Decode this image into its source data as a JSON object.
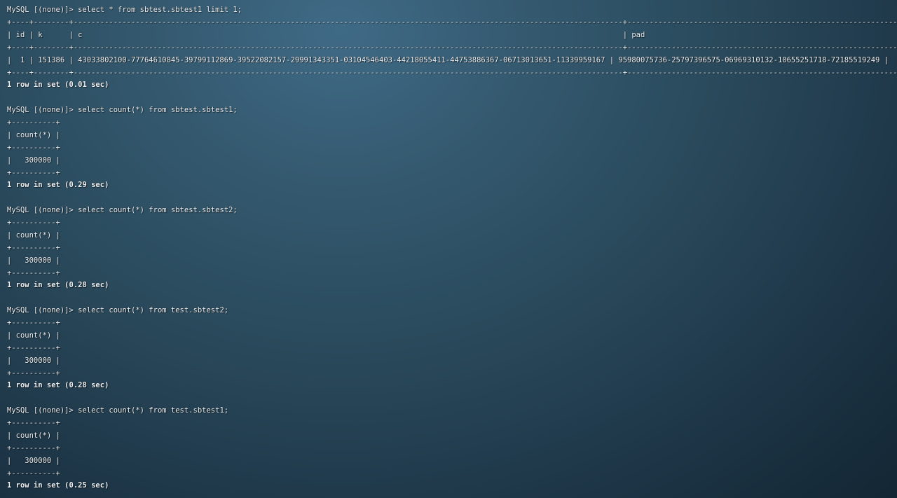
{
  "app": {
    "prompt": "MySQL [(none)]> "
  },
  "blocks": [
    {
      "command": "select * from sbtest.sbtest1 limit 1;",
      "border": "+----+--------+----------------------------------------------------------------------------------------------------------------------------+-------------------------------------------------------------+",
      "header": "| id | k      | c                                                                                                                          | pad                                                         |",
      "row": "|  1 | 151386 | 43033802100-77764610845-39799112869-39522082157-29991343351-03104546403-44218055411-44753886367-06713013651-11339959167 | 95980075736-25797396575-06969310132-10655251718-72185519249 |",
      "summary": "1 row in set (0.01 sec)"
    },
    {
      "command": "select count(*) from sbtest.sbtest1;",
      "border": "+----------+",
      "header": "| count(*) |",
      "row": "|   300000 |",
      "summary": "1 row in set (0.29 sec)"
    },
    {
      "command": "select count(*) from sbtest.sbtest2;",
      "border": "+----------+",
      "header": "| count(*) |",
      "row": "|   300000 |",
      "summary": "1 row in set (0.28 sec)"
    },
    {
      "command": "select count(*) from test.sbtest2;",
      "border": "+----------+",
      "header": "| count(*) |",
      "row": "|   300000 |",
      "summary": "1 row in set (0.28 sec)"
    },
    {
      "command": "select count(*) from test.sbtest1;",
      "border": "+----------+",
      "header": "| count(*) |",
      "row": "|   300000 |",
      "summary": "1 row in set (0.25 sec)"
    }
  ]
}
